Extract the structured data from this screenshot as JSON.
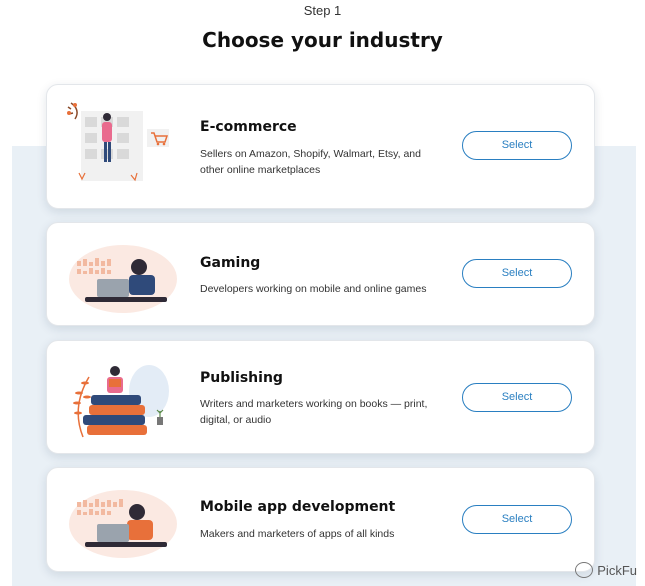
{
  "header": {
    "step": "Step 1",
    "title": "Choose your industry"
  },
  "industries": [
    {
      "title": "E-commerce",
      "description": "Sellers on Amazon, Shopify, Walmart, Etsy, and other online marketplaces",
      "button": "Select",
      "illustration": "ecommerce-shopper-illustration"
    },
    {
      "title": "Gaming",
      "description": "Developers working on mobile and online games",
      "button": "Select",
      "illustration": "gamer-laptop-illustration"
    },
    {
      "title": "Publishing",
      "description": "Writers and marketers working on books — print, digital, or audio",
      "button": "Select",
      "illustration": "reader-books-illustration"
    },
    {
      "title": "Mobile app development",
      "description": "Makers and marketers of apps of all kinds",
      "button": "Select",
      "illustration": "developer-laptop-illustration"
    }
  ],
  "watermark": {
    "text": "PickFu"
  },
  "colors": {
    "accent": "#2a7fc1",
    "band": "#e9f0f6",
    "illustration_orange": "#e8703a",
    "illustration_blue": "#2f4a7a"
  }
}
